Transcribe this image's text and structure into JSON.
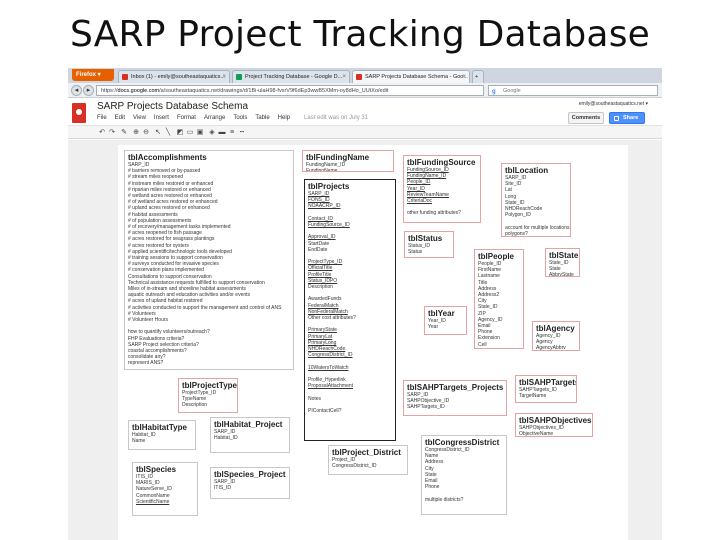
{
  "slide": {
    "title": "SARP Project Tracking Database"
  },
  "browser": {
    "menu_button": "Firefox ▾",
    "tabs": [
      {
        "label": "Inbox (1) - emily@southeastaquatics...",
        "fav_color": "#d93025"
      },
      {
        "label": "Project Tracking Database - Google D...",
        "fav_color": "#0f9d58"
      },
      {
        "label": "SARP Projects Database Schema - Goo...",
        "fav_color": "#d93025"
      }
    ],
    "url_prefix": "https://",
    "url_domain": "docs.google.com",
    "url_rest": "/a/southeastaquatics.net/drawings/d/1Bi-ulaH98-fvxrV9f6dEp3wwB5XMm-oy8dHo_UUtXo/edit",
    "search_placeholder": "Google"
  },
  "app": {
    "doc_title": "SARP Projects Database Schema",
    "menu": [
      "File",
      "Edit",
      "View",
      "Insert",
      "Format",
      "Arrange",
      "Tools",
      "Table",
      "Help"
    ],
    "last_edit": "Last edit was on July 31",
    "user_email": "emily@southeastaquatics.net ▾",
    "comments_label": "Comments",
    "share_label": "Share"
  },
  "tables": {
    "accomplishments": {
      "name": "tblAccomplishments",
      "fields": [
        "SARP_ID",
        "# barriers removed or by-passed",
        "# stream miles reopened",
        "# instream miles restored or enhanced",
        "# riparian miles restored or enhanced",
        "# wetland acres restored or enhanced",
        "# of wetland acres restored or enhanced",
        "# upland acres restored or enhanced",
        "# habitat assessments",
        "# of population assessments",
        "# of recovery/management tasks implemented",
        "# acres reopened to fish passage",
        "# acres restored for seagrass plantings",
        "# acres restored for oysters",
        "# applied scientific/technologic tools developed",
        "# training sessions to support conservation",
        "# surveys conducted for invasive species",
        "# conservation plans implemented",
        "Consultations to support conservation",
        "Technical assistance requests fulfilled to support conservation",
        "Miles of in-stream and shoreline habitat assessments",
        "aquatic outreach and education activities and/or events",
        "# acres of upland habitat restored",
        "# activities conducted to support the management and control of ANS",
        "# Volunteers",
        "# Volunteer Hours",
        "",
        "how to quantify volunteers/outreach?",
        "FHP Evaluations criteria?",
        "SARP Project selection criteria?",
        "coastal accomplishments?",
        "consolidate any?",
        "represent ANS?"
      ]
    },
    "funding_name": {
      "name": "tblFundingName",
      "fields": [
        "FundingName_ID",
        "FundingName"
      ]
    },
    "projects": {
      "name": "tblProjects",
      "fields": [
        "SARP_ID",
        "FONS_ID",
        "NOAACRP_ID",
        "",
        "Contact_ID",
        "FundingSource_ID",
        "",
        "Approval_ID",
        "StartDate",
        "EndDate",
        "",
        "ProjectType_ID",
        "OfficialTitle",
        "ProfileTitle",
        "Status_IDPO",
        "Description",
        "",
        "AwardedFunds",
        "FederalMatch",
        "NonFederalMatch",
        "Other cost attributes?",
        "",
        "PrimaryState",
        "PrimaryLat",
        "PrimaryLong",
        "NHDReachCode",
        "CongressDistrict_ID",
        "",
        "10WatersToWatch",
        "",
        "Profile_Hyperlink",
        "ProposalAttachment",
        "",
        "Notes",
        "",
        "PIContactCell?"
      ]
    },
    "funding_source": {
      "name": "tblFundingSource",
      "fields": [
        "FundingSource_ID",
        "FundingName_ID",
        "People_ID",
        "Year_ID",
        "ReviewTeamName",
        "CriteriaDoc",
        "",
        "other funding attributes?"
      ]
    },
    "location": {
      "name": "tblLocation",
      "fields": [
        "SARP_ID",
        "Site_ID",
        "Lat",
        "Long",
        "State_ID",
        "NHDReachCode",
        "Polygon_ID",
        "",
        "account for multiple locations?",
        "polygons?"
      ]
    },
    "status": {
      "name": "tblStatus",
      "fields": [
        "Status_ID",
        "Status"
      ]
    },
    "people": {
      "name": "tblPeople",
      "fields": [
        "People_ID",
        "FirstName",
        "Lastname",
        "Title",
        "Address",
        "Address2",
        "City",
        "State_ID",
        "ZIP",
        "Agency_ID",
        "Email",
        "Phone",
        "Extension",
        "Cell"
      ]
    },
    "state": {
      "name": "tblState",
      "fields": [
        "State_ID",
        "State",
        "AbbrvState"
      ]
    },
    "year": {
      "name": "tblYear",
      "fields": [
        "Year_ID",
        "Year"
      ]
    },
    "agency": {
      "name": "tblAgency",
      "fields": [
        "Agency_ID",
        "Agency",
        "AgencyAbbrv"
      ]
    },
    "project_type": {
      "name": "tblProjectType",
      "fields": [
        "ProjectType_ID",
        "TypeName",
        "Description"
      ]
    },
    "sahp_targets_projects": {
      "name": "tblSAHPTargets_Projects",
      "fields": [
        "SARP_ID",
        "SAHPObjective_ID",
        "SAHPTargets_ID"
      ]
    },
    "sahp_targets": {
      "name": "tblSAHPTargets",
      "fields": [
        "SAHPTargets_ID",
        "TargetName"
      ]
    },
    "sahp_objectives": {
      "name": "tblSAHPObjectives",
      "fields": [
        "SAHPObjectives_ID",
        "ObjectiveName"
      ]
    },
    "habitat_type": {
      "name": "tblHabitatType",
      "fields": [
        "Habitat_ID",
        "Name"
      ]
    },
    "habitat_project": {
      "name": "tblHabitat_Project",
      "fields": [
        "SARP_ID",
        "Habitat_ID"
      ]
    },
    "project_district": {
      "name": "tblProject_District",
      "fields": [
        "Project_ID",
        "CongressDistrict_ID"
      ]
    },
    "congress_district": {
      "name": "tblCongressDistrict",
      "fields": [
        "CongressDistrict_ID",
        "Name",
        "Address",
        "City",
        "State",
        "Email",
        "Phone",
        "",
        "multiple districts?"
      ]
    },
    "species": {
      "name": "tblSpecies",
      "fields": [
        "ITIS_ID",
        "MARIS_ID",
        "NatureServe_ID",
        "CommonName",
        "ScientificName"
      ]
    },
    "species_project": {
      "name": "tblSpecies_Project",
      "fields": [
        "SARP_ID",
        "ITIS_ID"
      ]
    }
  }
}
